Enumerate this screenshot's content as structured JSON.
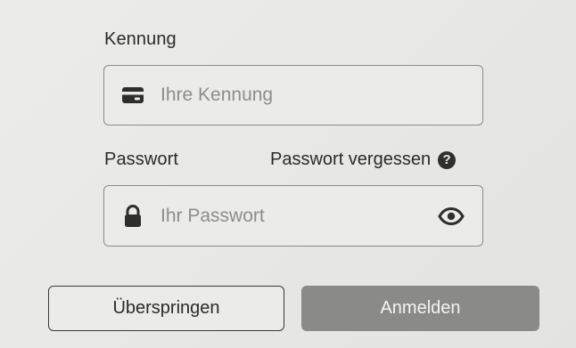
{
  "form": {
    "id_label": "Kennung",
    "id_placeholder": "Ihre Kennung",
    "id_value": "",
    "password_label": "Passwort",
    "password_placeholder": "Ihr Passwort",
    "password_value": "",
    "forgot_label": "Passwort vergessen"
  },
  "icons": {
    "id_field": "id-card-icon",
    "password_field": "lock-icon",
    "toggle_visibility": "eye-icon",
    "help": "question-circle-icon"
  },
  "buttons": {
    "skip_label": "Überspringen",
    "login_label": "Anmelden"
  },
  "colors": {
    "background": "#e9e9e7",
    "field_border": "#8b8b89",
    "primary_button_disabled": "#8a8a89",
    "text": "#2a2a2a",
    "placeholder": "#8d8d8b"
  }
}
